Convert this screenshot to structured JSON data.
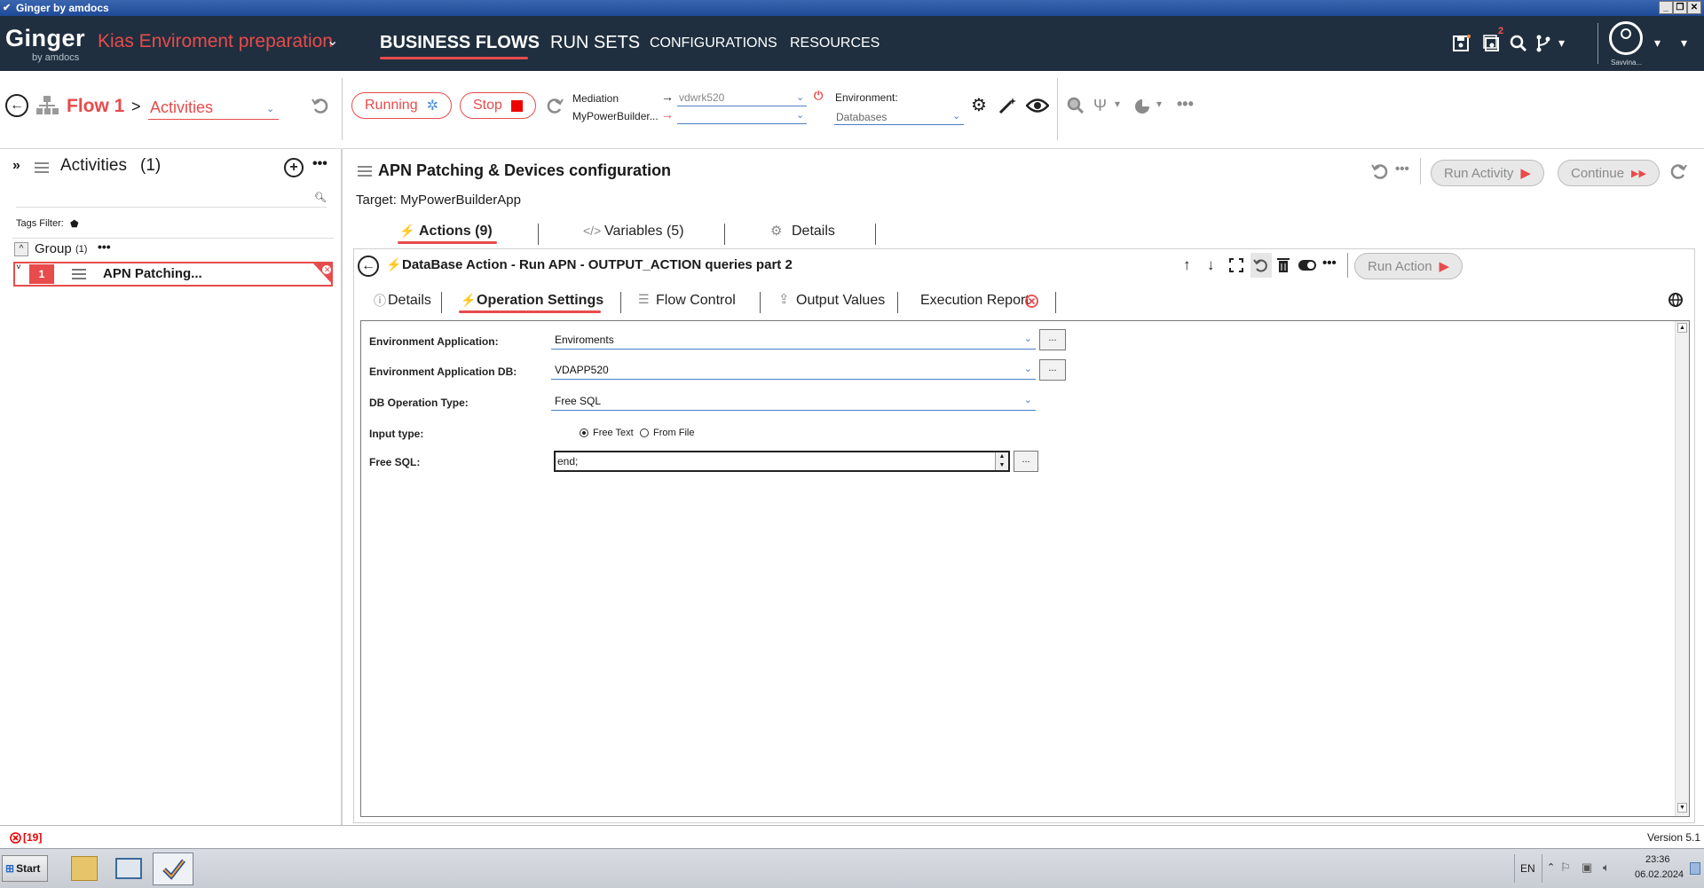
{
  "window": {
    "title": "Ginger by amdocs"
  },
  "header": {
    "logo": "Ginger",
    "logo_sub": "by amdocs",
    "solution": "Kias Enviroment preparation",
    "menu": [
      "BUSINESS FLOWS",
      "RUN SETS",
      "CONFIGURATIONS",
      "RESOURCES"
    ],
    "notification_count": "2",
    "user_name": "Savvina..."
  },
  "toolbar": {
    "flow_title": "Flow 1",
    "separator": ">",
    "view_select": "Activities",
    "running_label": "Running",
    "stop_label": "Stop",
    "mediation_label": "Mediation",
    "mediation_value": "vdwrk520",
    "app_label": "MyPowerBuilder...",
    "app_value": "",
    "environment_label": "Environment:",
    "environment_value": "Databases"
  },
  "left": {
    "title": "Activities",
    "count": "(1)",
    "search_placeholder": "",
    "tags_filter": "Tags Filter:",
    "group_label": "Group",
    "group_count": "(1)",
    "activity_index": "1",
    "activity_name": "APN Patching..."
  },
  "activity": {
    "title": "APN Patching & Devices configuration",
    "target": "Target: MyPowerBuilderApp",
    "run_activity": "Run Activity",
    "continue": "Continue",
    "tabs": [
      "Actions (9)",
      "Variables (5)",
      "Details"
    ]
  },
  "action": {
    "title": "DataBase Action - Run APN - OUTPUT_ACTION queries part 2",
    "run_action": "Run Action",
    "tabs": [
      "Details",
      "Operation Settings",
      "Flow Control",
      "Output Values",
      "Execution Report"
    ]
  },
  "form": {
    "env_app_label": "Environment Application:",
    "env_app_value": "Enviroments",
    "env_app_db_label": "Environment Application DB:",
    "env_app_db_value": "VDAPP520",
    "op_type_label": "DB Operation Type:",
    "op_type_value": "Free SQL",
    "input_type_label": "Input type:",
    "radio_free_text": "Free Text",
    "radio_from_file": "From File",
    "free_sql_label": "Free SQL:",
    "free_sql_value": "end;",
    "browse_label": "..."
  },
  "status": {
    "errors": "[19]",
    "version": "Version 5.1"
  },
  "taskbar": {
    "start": "Start",
    "lang": "EN",
    "time": "23:36",
    "date": "06.02.2024"
  },
  "colors": {
    "accent": "#e84b4b",
    "header_bg": "#1f2f3f",
    "link": "#4a7fc0"
  }
}
